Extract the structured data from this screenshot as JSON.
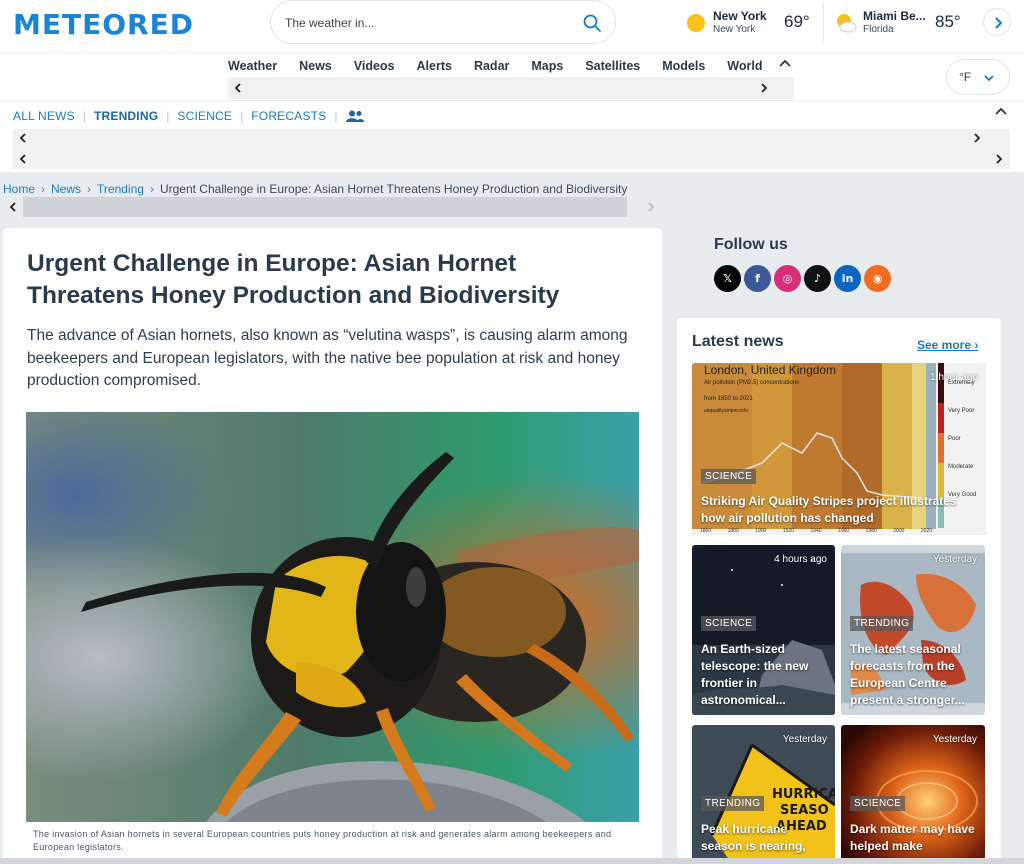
{
  "header": {
    "logo": "METEORED",
    "search_placeholder": "The weather in...",
    "locations": [
      {
        "city": "New York",
        "region": "New York",
        "temp": "69°",
        "icon": "sun-icon"
      },
      {
        "city": "Miami Be...",
        "region": "Florida",
        "temp": "85°",
        "icon": "partly-cloudy-icon"
      }
    ]
  },
  "mainnav": {
    "items": [
      "Weather",
      "News",
      "Videos",
      "Alerts",
      "Radar",
      "Maps",
      "Satellites",
      "Models",
      "World"
    ],
    "unit": "°F"
  },
  "subnav": {
    "links": [
      {
        "label": "ALL NEWS",
        "active": false
      },
      {
        "label": "TRENDING",
        "active": true
      },
      {
        "label": "SCIENCE",
        "active": false
      },
      {
        "label": "FORECASTS",
        "active": false
      }
    ],
    "icon": "authors-icon"
  },
  "breadcrumb": {
    "home": "Home",
    "news": "News",
    "trending": "Trending",
    "current": "Urgent Challenge in Europe: Asian Hornet Threatens Honey Production and Biodiversity"
  },
  "article": {
    "title": "Urgent Challenge in Europe: Asian Hornet Threatens Honey Production and Biodiversity",
    "lead": "The advance of Asian hornets, also known as “velutina wasps”, is causing alarm among beekeepers and European legislators, with the native bee population at risk and honey production compromised.",
    "caption": "The invasion of Asian hornets in several European countries puts honey production at risk and generates alarm among beekeepers and European legislators."
  },
  "sidebar": {
    "follow_title": "Follow us",
    "socials": [
      {
        "name": "x-icon",
        "glyph": "𝕏",
        "color": "#000000"
      },
      {
        "name": "facebook-icon",
        "glyph": "f",
        "color": "#3b5998"
      },
      {
        "name": "instagram-icon",
        "glyph": "◎",
        "color": "#d6307a"
      },
      {
        "name": "tiktok-icon",
        "glyph": "♪",
        "color": "#111111"
      },
      {
        "name": "linkedin-icon",
        "glyph": "in",
        "color": "#0a66c2"
      },
      {
        "name": "rss-icon",
        "glyph": "◉",
        "color": "#f26b21"
      }
    ],
    "latest_title": "Latest news",
    "see_more": "See more",
    "cards": [
      {
        "time": "1 hour ago",
        "tag": "SCIENCE",
        "title": "Striking Air Quality Stripes project illustrates how air pollution has changed",
        "overlay": {
          "city": "London, United Kingdom",
          "subtitle": "Air pollution (PM2.5) concentrations",
          "range": "from 1850 to 2021",
          "site": "airqualitystripes.info",
          "legend": [
            "Extremely",
            "Very Poor",
            "Poor",
            "Moderate",
            "Very Good"
          ],
          "years": [
            "1860",
            "1880",
            "1900",
            "1920",
            "1940",
            "1960",
            "1980",
            "2000",
            "2020"
          ]
        }
      },
      {
        "time": "4 hours ago",
        "tag": "SCIENCE",
        "title": "An Earth-sized telescope: the new frontier in astronomical..."
      },
      {
        "time": "Yesterday",
        "tag": "TRENDING",
        "title": "The latest seasonal forecasts from the European Centre present a stronger..."
      },
      {
        "time": "Yesterday",
        "tag": "TRENDING",
        "title": "Peak hurricane season is nearing,",
        "sign_text": [
          "HURRICA",
          "SEASO",
          "AHEAD"
        ]
      },
      {
        "time": "Yesterday",
        "tag": "SCIENCE",
        "title": "Dark matter may have helped make"
      }
    ]
  }
}
